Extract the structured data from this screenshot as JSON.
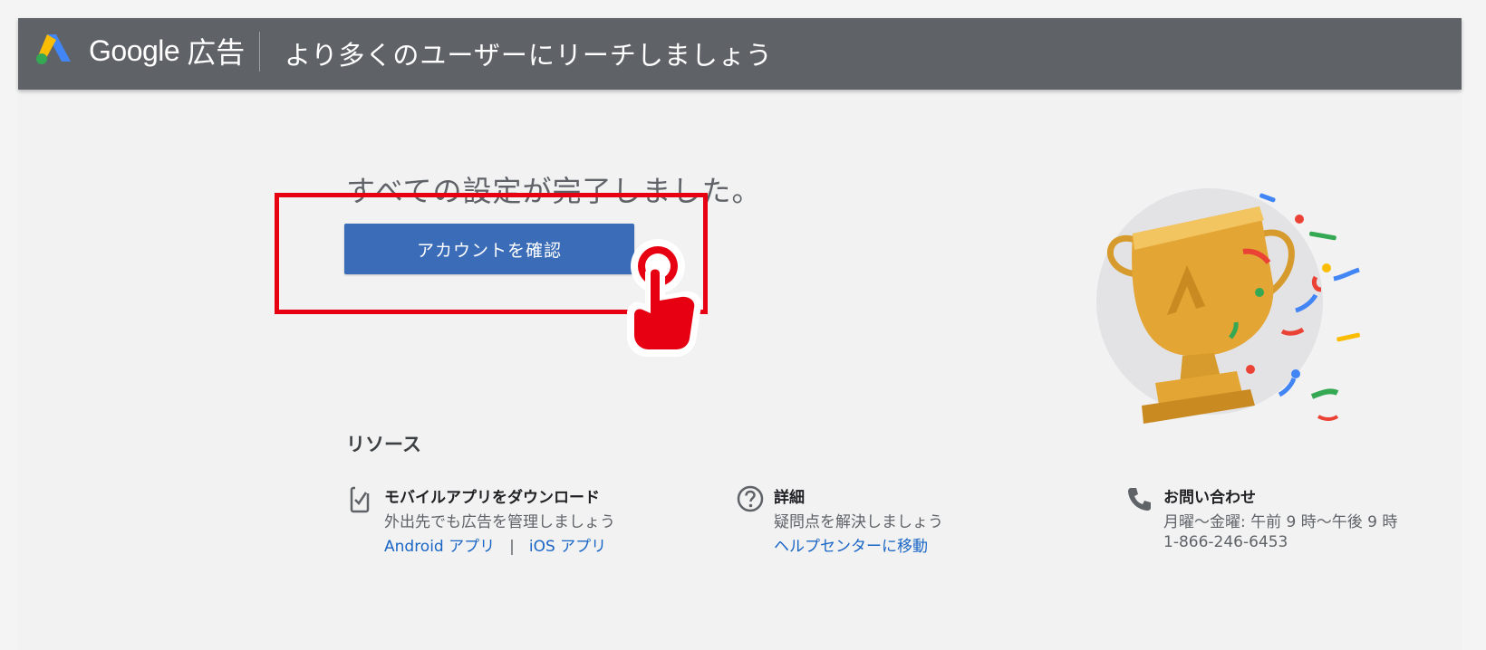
{
  "header": {
    "brand_google": "Google",
    "brand_ads": "広告",
    "tagline": "より多くのユーザーにリーチしましょう"
  },
  "main": {
    "headline": "すべての設定が完了しました。",
    "primary_button_label": "アカウントを確認"
  },
  "resources": {
    "title": "リソース",
    "mobile": {
      "icon": "phone-check-icon",
      "title": "モバイルアプリをダウンロード",
      "description": "外出先でも広告を管理しましょう",
      "android_link": "Android アプリ",
      "separator": "|",
      "ios_link": "iOS アプリ"
    },
    "details": {
      "icon": "help-circle-icon",
      "title": "詳細",
      "description": "疑問点を解決しましょう",
      "link": "ヘルプセンターに移動"
    },
    "contact": {
      "icon": "phone-icon",
      "title": "お問い合わせ",
      "hours": "月曜〜金曜: 午前 9 時〜午後 9 時",
      "phone": "1-866-246-6453"
    }
  },
  "colors": {
    "header_bg": "#5f6368",
    "button_bg": "#3b6cb8",
    "highlight_red": "#e60012",
    "link_blue": "#1a66c6",
    "trophy_gold": "#e3a534"
  }
}
